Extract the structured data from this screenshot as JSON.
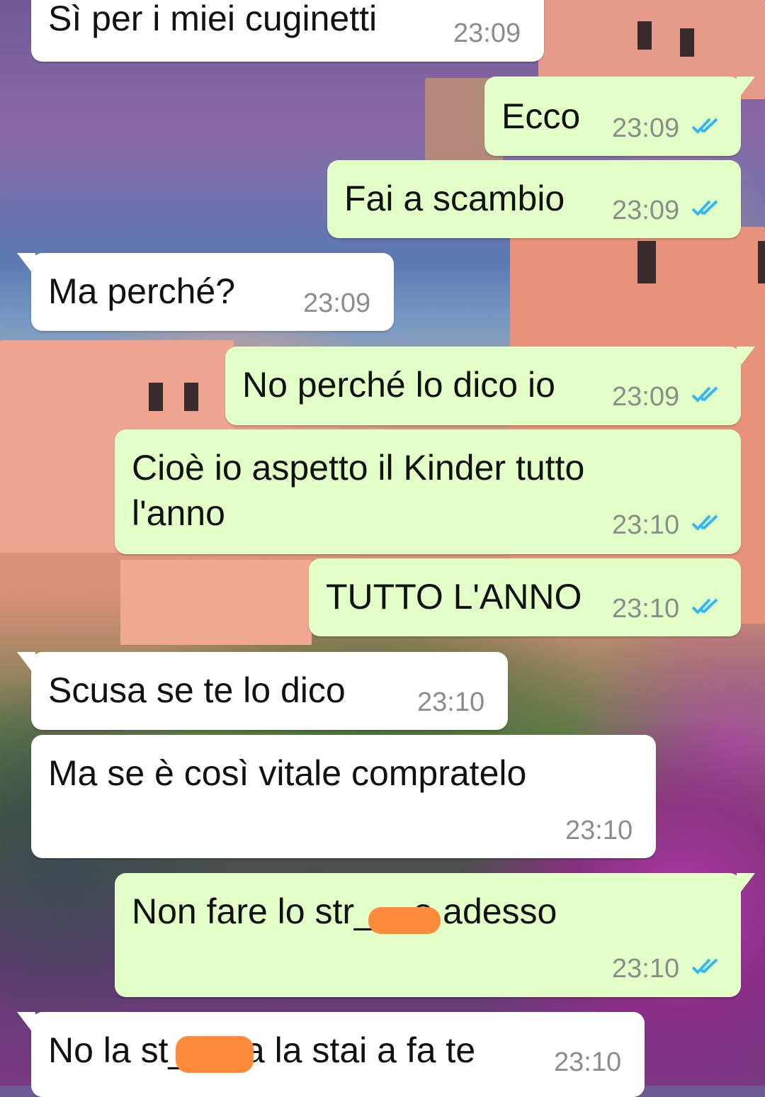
{
  "chat": {
    "messages": [
      {
        "direction": "in",
        "text": "Sì per i miei cuginetti",
        "time": "23:09"
      },
      {
        "direction": "out",
        "text": "Ecco",
        "time": "23:09",
        "read": true
      },
      {
        "direction": "out",
        "text": "Fai a scambio",
        "time": "23:09",
        "read": true
      },
      {
        "direction": "in",
        "text": "Ma perché?",
        "time": "23:09"
      },
      {
        "direction": "out",
        "text": "No perché lo dico io",
        "time": "23:09",
        "read": true
      },
      {
        "direction": "out",
        "text_line1": "Cioè io aspetto il Kinder tutto",
        "text_line2": "l'anno",
        "time": "23:10",
        "read": true
      },
      {
        "direction": "out",
        "text": "TUTTO L'ANNO",
        "time": "23:10",
        "read": true
      },
      {
        "direction": "in",
        "text": "Scusa se te lo dico",
        "time": "23:10"
      },
      {
        "direction": "in",
        "text": "Ma se è così vitale compratelo",
        "time": "23:10"
      },
      {
        "direction": "out",
        "text": "Non fare lo str___o adesso",
        "time": "23:10",
        "read": true,
        "redacted": true
      },
      {
        "direction": "in",
        "text": "No la st___za la stai a fa te",
        "time": "23:10",
        "redacted": true
      }
    ]
  },
  "colors": {
    "incoming_bubble": "#ffffff",
    "outgoing_bubble": "#e2ffc7",
    "read_ticks": "#34b7f1",
    "redaction": "#ff8a3c"
  }
}
